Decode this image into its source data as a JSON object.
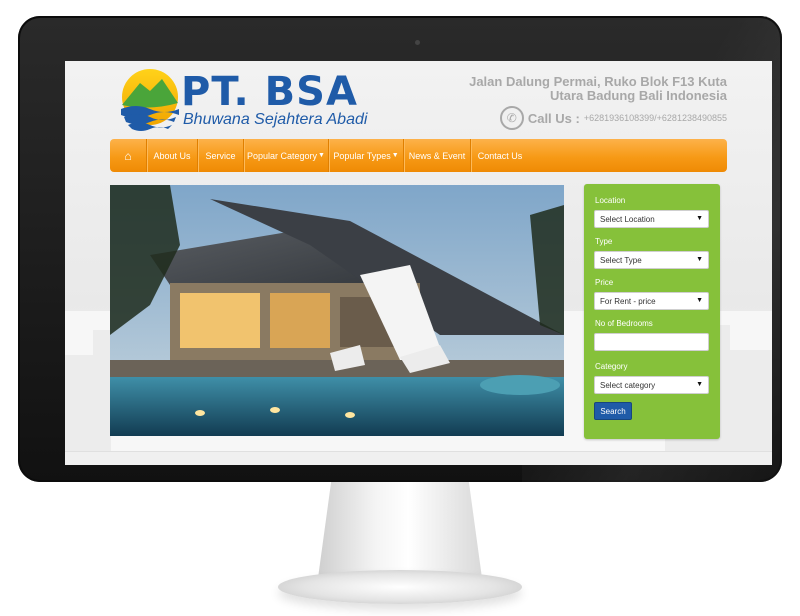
{
  "header": {
    "brand_title": "PT. BSA",
    "brand_subtitle": "Bhuwana Sejahtera Abadi",
    "address_line1": "Jalan Dalung Permai, Ruko Blok F13 Kuta",
    "address_line2": "Utara Badung Bali Indonesia",
    "contact_label": "Call Us :",
    "contact_numbers": "+6281936108399/+6281238490855",
    "icons": {
      "logo": "mountain-wave-logo-icon",
      "phone": "phone-icon"
    }
  },
  "nav": {
    "home_icon": "home-icon",
    "items": [
      {
        "label": "About Us"
      },
      {
        "label": "Service"
      },
      {
        "label": "Popular Category"
      },
      {
        "label": "Popular Types"
      },
      {
        "label": "News & Event"
      },
      {
        "label": "Contact Us"
      }
    ]
  },
  "search": {
    "location_label": "Location",
    "location_value": "Select Location",
    "type_label": "Type",
    "type_value": "Select Type",
    "price_label": "Price",
    "price_value": "For Rent - price",
    "bedrooms_label": "No of Bedrooms",
    "bedrooms_value": "",
    "category_label": "Category",
    "category_value": "Select category",
    "search_button": "Search"
  },
  "colors": {
    "brand_blue": "#1f5ba8",
    "nav_orange": "#f79a16",
    "panel_green": "#86c13a",
    "header_gray": "#a8a8a8"
  }
}
